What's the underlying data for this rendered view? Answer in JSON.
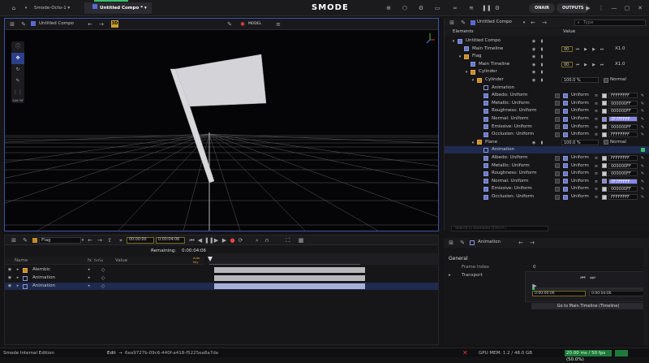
{
  "topbar": {
    "tab1": "Smode-Octo-1",
    "tab2": "Untitled Compo",
    "tab2_star": "*",
    "logo": "SMODE",
    "onair": "ONAIR",
    "outputs": "OUTPUTS"
  },
  "viewport": {
    "compo": "Untitled Compo",
    "model_label": "MODEL",
    "edit_label": "Edit Off"
  },
  "right": {
    "compo": "Untitled Compo",
    "search": "Type",
    "tab_elements": "Elements",
    "tab_value": "Value",
    "rows": [
      {
        "label": "Untitled Compo",
        "depth": 0,
        "kind": "compo"
      },
      {
        "label": "Main Timeline",
        "depth": 1,
        "kind": "tl",
        "tc": "00:",
        "speed": "X1.0"
      },
      {
        "label": "Flag",
        "depth": 1,
        "kind": "folder"
      },
      {
        "label": "Main Timeline",
        "depth": 2,
        "kind": "tl",
        "tc": "00:",
        "speed": "X1.0"
      },
      {
        "label": "Cylinder",
        "depth": 2,
        "kind": "folder"
      },
      {
        "label": "Cylinder",
        "depth": 3,
        "kind": "model",
        "pct": "100.0 %",
        "mode": "Normal"
      },
      {
        "label": "Animation",
        "depth": 4,
        "kind": "anim"
      },
      {
        "label": "Albedo: Uniform",
        "depth": 4,
        "kind": "u",
        "uval": "Uniform",
        "hex": "FFFFFFFF"
      },
      {
        "label": "Metallic: Uniform",
        "depth": 4,
        "kind": "u",
        "uval": "Uniform",
        "hex": "000000FF"
      },
      {
        "label": "Roughness: Uniform",
        "depth": 4,
        "kind": "u",
        "uval": "Uniform",
        "hex": "000000FF"
      },
      {
        "label": "Normal: Uniform",
        "depth": 4,
        "kind": "u",
        "uval": "Uniform",
        "hex": "7F7FFFFF",
        "hl": "#8888ee"
      },
      {
        "label": "Emissive: Uniform",
        "depth": 4,
        "kind": "u",
        "uval": "Uniform",
        "hex": "000000FF"
      },
      {
        "label": "Occlusion: Uniform",
        "depth": 4,
        "kind": "u",
        "uval": "Uniform",
        "hex": "FFFFFFFF"
      },
      {
        "label": "Plane",
        "depth": 3,
        "kind": "model",
        "pct": "100.0 %",
        "mode": "Normal"
      },
      {
        "label": "Animation",
        "depth": 4,
        "kind": "anim",
        "sel": true
      },
      {
        "label": "Albedo: Uniform",
        "depth": 4,
        "kind": "u",
        "uval": "Uniform",
        "hex": "FFFFFFFF"
      },
      {
        "label": "Metallic: Uniform",
        "depth": 4,
        "kind": "u",
        "uval": "Uniform",
        "hex": "000000FF"
      },
      {
        "label": "Roughness: Uniform",
        "depth": 4,
        "kind": "u",
        "uval": "Uniform",
        "hex": "000000FF"
      },
      {
        "label": "Normal: Uniform",
        "depth": 4,
        "kind": "u",
        "uval": "Uniform",
        "hex": "7F7FFFFF",
        "hl": "#8888ee"
      },
      {
        "label": "Emissive: Uniform",
        "depth": 4,
        "kind": "u",
        "uval": "Uniform",
        "hex": "000000FF"
      },
      {
        "label": "Occlusion: Uniform",
        "depth": 4,
        "kind": "u",
        "uval": "Uniform",
        "hex": "FFFFFFFF"
      }
    ],
    "bottom_search": "Search in Elements (Ctrl+F)"
  },
  "timeline": {
    "name": "Flag",
    "tc_start": "00:00:00",
    "tc_end": "0:00:04:06",
    "remaining_label": "Remaining:",
    "remaining": "0:00:04:06",
    "col_name": "Name",
    "col_fx": "fx",
    "col_fx2": "fxnSu",
    "col_value": "Value",
    "auto_key": "Auto Key",
    "rows": [
      {
        "label": "Alembic"
      },
      {
        "label": "Animation"
      },
      {
        "label": "Animation",
        "sel": true
      }
    ]
  },
  "inspector": {
    "title": "Animation",
    "section": "General",
    "frame_index_label": "Frame Index",
    "frame_index": "0",
    "transport": "Transport",
    "tc1": "0:00:00:06",
    "tc2": "0:00:04:06",
    "goto": "Go to Main Timeline (Timeline)"
  },
  "status": {
    "edition": "Smode Internal Edition",
    "edit": "Edit",
    "uuid": "6ea9727b-09c6-440f-a418-f5225ea8a7de",
    "gpu": "GPU MEM: 1.2 / 48.0 GB",
    "fps": "20.00 ms / 50 fps (50.0%)"
  }
}
